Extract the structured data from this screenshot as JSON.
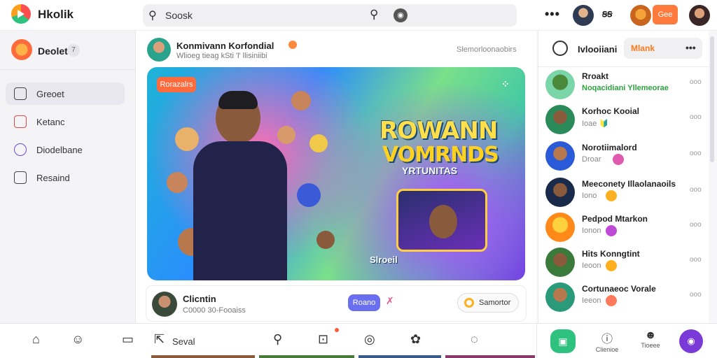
{
  "app": {
    "brand": "Hkolik"
  },
  "search": {
    "placeholder": "Soosk"
  },
  "topbar": {
    "more": "•••",
    "glyph": "ꞩꞩ",
    "badge": "Gee"
  },
  "sidebar": {
    "title": "Deolet",
    "count": "7",
    "items": [
      {
        "label": "Greoet",
        "icon": "home-icon",
        "active": true
      },
      {
        "label": "Ketanc",
        "icon": "bookmark-icon",
        "active": false
      },
      {
        "label": "Diodelbane",
        "icon": "compass-icon",
        "active": false
      },
      {
        "label": "Resaind",
        "icon": "history-icon",
        "active": false
      }
    ]
  },
  "post": {
    "author": "Konmivann Korfondial",
    "subtitle": "Wlioeg tieag kSti 'l' llisiniibi",
    "meta": "Slemorloonaobirs",
    "hero_tag": "Rorazalrs",
    "hero_title_1": "ROWANN",
    "hero_title_2": "VOMRNDS",
    "hero_subtitle": "YRTUNITAS",
    "hero_cta": "Slroeil",
    "more_glyph": "⁘"
  },
  "creator": {
    "name": "Clicntin",
    "sub": "C0000 30-Fooaiss",
    "follow": "Roano",
    "share": "Samortor",
    "icon_glyph": "✗"
  },
  "rpanel": {
    "title": "Ivlooiiani",
    "tag": "Mlank",
    "more": "•••",
    "items": [
      {
        "name": "Rroakt",
        "status": "Noqacidiani Yllemeorae",
        "status_green": true,
        "emoji_color": ""
      },
      {
        "name": "Korhoc Kooial",
        "status": "Ioae 🔰",
        "status_green": false,
        "emoji_color": "#ffc83d"
      },
      {
        "name": "Norotiimalord",
        "status": "Droar",
        "status_green": false,
        "emoji_color": "#e05ab0"
      },
      {
        "name": "Meeconety Illaolanaoils",
        "status": "Iono",
        "status_green": false,
        "emoji_color": "#ffb020"
      },
      {
        "name": "Pedpod Mtarkon",
        "status": "Ionon",
        "status_green": false,
        "emoji_color": "#c04ad8"
      },
      {
        "name": "Hits Konngtint",
        "status": "Ieoon",
        "status_green": false,
        "emoji_color": "#ffb020"
      },
      {
        "name": "Cortunaeoc Vorale",
        "status": "Ieeon",
        "status_green": false,
        "emoji_color": "#ff7a5a"
      }
    ],
    "item_option": "ooo"
  },
  "bottombar": {
    "label": "Seval",
    "r1_label": "Clienioe",
    "r2_label": "Tioeee"
  },
  "colors": {
    "accent_orange": "#ff7a3d",
    "accent_green": "#2ec27e",
    "accent_purple": "#7a3ad8",
    "follow_blue": "#6a6ff0"
  }
}
